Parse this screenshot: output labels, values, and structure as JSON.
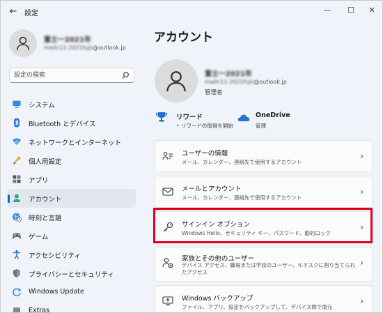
{
  "window": {
    "title": "設定",
    "controls": {
      "minimize": "—",
      "maximize": "☐",
      "close": "✕"
    }
  },
  "sidebar": {
    "profile": {
      "name": "富士一2021年",
      "email_prefix": "mailn11-2021fujii",
      "email_domain": "@outlook.jp"
    },
    "search": {
      "placeholder": "設定の検索"
    },
    "items": [
      {
        "label": "システム",
        "icon": "monitor-icon",
        "active": false
      },
      {
        "label": "Bluetooth とデバイス",
        "icon": "bluetooth-icon",
        "active": false
      },
      {
        "label": "ネットワークとインターネット",
        "icon": "wifi-icon",
        "active": false
      },
      {
        "label": "個人用設定",
        "icon": "brush-icon",
        "active": false
      },
      {
        "label": "アプリ",
        "icon": "apps-icon",
        "active": false
      },
      {
        "label": "アカウント",
        "icon": "person-icon",
        "active": true
      },
      {
        "label": "時刻と言語",
        "icon": "globe-clock-icon",
        "active": false
      },
      {
        "label": "ゲーム",
        "icon": "gamepad-icon",
        "active": false
      },
      {
        "label": "アクセシビリティ",
        "icon": "accessibility-icon",
        "active": false
      },
      {
        "label": "プライバシーとセキュリティ",
        "icon": "shield-icon",
        "active": false
      },
      {
        "label": "Windows Update",
        "icon": "update-icon",
        "active": false
      },
      {
        "label": "Extras",
        "icon": "extras-icon",
        "active": false
      }
    ]
  },
  "main": {
    "title": "アカウント",
    "account": {
      "name": "富士一2021年",
      "email_prefix": "mailn11-2021fujii",
      "email_domain": "@outlook.jp",
      "role": "管理者"
    },
    "rewards": {
      "title": "リワード",
      "subtitle": "リワードの取得を開始",
      "bullet": "•"
    },
    "onedrive": {
      "title": "OneDrive",
      "subtitle": "管理"
    },
    "cards": [
      {
        "title": "ユーザーの情報",
        "desc": "メール、カレンダー、連絡先で使用するアカウント",
        "icon": "user-info-icon"
      },
      {
        "title": "メールとアカウント",
        "desc": "メール、カレンダー、連絡先で使用するアカウント",
        "icon": "mail-icon"
      },
      {
        "title": "サインイン オプション",
        "desc": "Windows Hello、セキュリティ キー、パスワード、動的ロック",
        "icon": "key-icon",
        "highlighted": true
      },
      {
        "title": "家族とその他のユーザー",
        "desc": "デバイス アクセス、職場または学校のユーザー、キオスクに割り当てられたアクセス",
        "icon": "family-icon"
      },
      {
        "title": "Windows バックアップ",
        "desc": "ファイル、アプリ、設定をバックアップして、デバイス間で復元",
        "icon": "backup-icon"
      }
    ],
    "chevron": "›"
  },
  "colors": {
    "accent": "#0067c0",
    "highlight": "#e0001b"
  }
}
